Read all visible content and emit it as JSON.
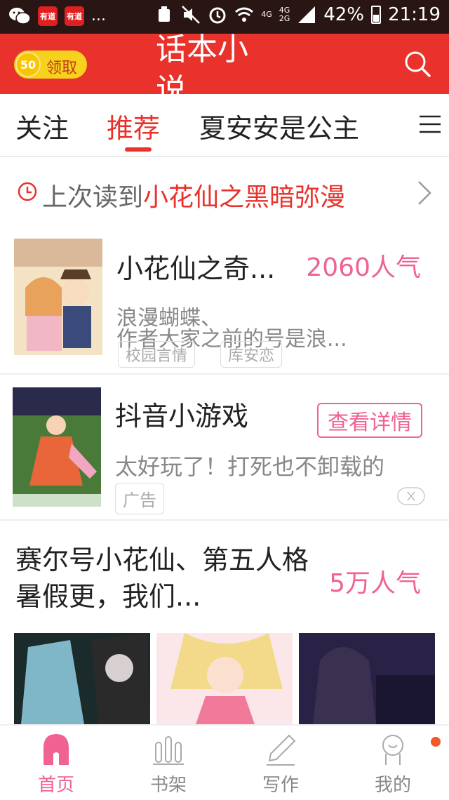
{
  "status_bar": {
    "app_badges": [
      "有道",
      "有道"
    ],
    "more": "...",
    "network": [
      "4G",
      "4G",
      "2G"
    ],
    "battery": "42%",
    "time": "21:19"
  },
  "app_bar": {
    "coin_count": "50",
    "coin_label": "领取",
    "title": "话本小说"
  },
  "tabs": [
    {
      "label": "关注",
      "active": false
    },
    {
      "label": "推荐",
      "active": true
    },
    {
      "label": "夏安安是公主",
      "active": false
    }
  ],
  "last_read": {
    "prefix": "上次读到",
    "book": "小花仙之黑暗弥漫"
  },
  "books": [
    {
      "title": "小花仙之奇...",
      "popularity": "2060人气",
      "author": "浪漫蝴蝶、",
      "description": "作者大家之前的号是浪...",
      "tags": [
        "校园言情",
        "库安恋"
      ]
    }
  ],
  "ad": {
    "title": "抖音小游戏",
    "action": "查看详情",
    "description": "太好玩了！打死也不卸载的",
    "tag": "广告"
  },
  "collection": {
    "title": "赛尔号小花仙、第五人格暑假更，我们...",
    "popularity": "5万人气"
  },
  "bottom_nav": [
    {
      "label": "首页",
      "active": true
    },
    {
      "label": "书架",
      "active": false
    },
    {
      "label": "写作",
      "active": false
    },
    {
      "label": "我的",
      "active": false
    }
  ],
  "colors": {
    "accent": "#e8322b",
    "pink": "#f06292",
    "status_bar": "#2a1515"
  }
}
